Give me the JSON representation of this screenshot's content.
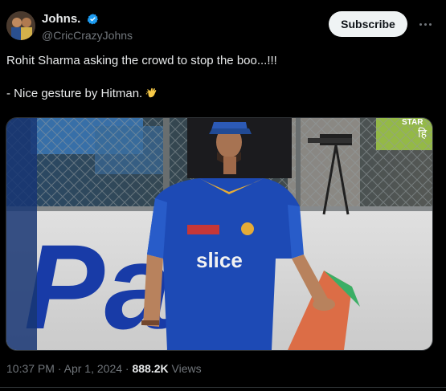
{
  "author": {
    "display_name": "Johns.",
    "handle": "@CricCrazyJohns",
    "verified": true
  },
  "subscribe_label": "Subscribe",
  "tweet": {
    "line1": "Rohit Sharma asking the crowd to stop the boo...!!!",
    "line2": "- Nice gesture by Hitman.",
    "emoji": "clapping-hands"
  },
  "media": {
    "jersey_text": "slice",
    "board_text": "Pay",
    "corner_text": "STAR",
    "corner_text2": "हि"
  },
  "meta": {
    "time": "10:37 PM",
    "separator1": "·",
    "date": "Apr 1, 2024",
    "separator2": "·",
    "views_count": "888.2K",
    "views_label": "Views"
  },
  "colors": {
    "background": "#000000",
    "text_primary": "#e7e9ea",
    "text_secondary": "#71767b",
    "verified_blue": "#1d9bf0",
    "subscribe_bg": "#eff3f4",
    "jersey_blue": "#1f4fbf"
  }
}
